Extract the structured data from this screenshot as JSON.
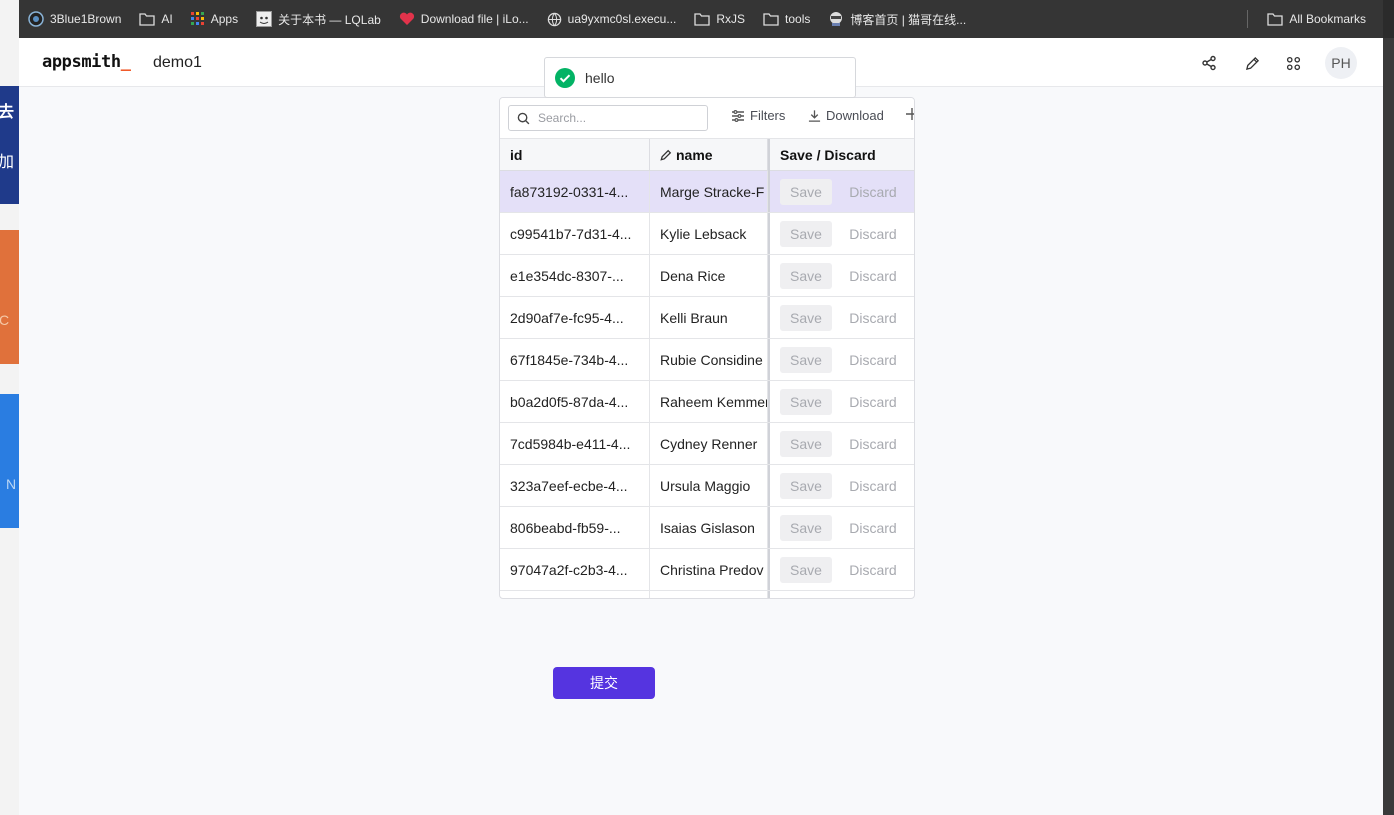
{
  "background_window": {
    "fragments": [
      "去",
      "加",
      "C",
      "N"
    ]
  },
  "bookmarks": {
    "items": [
      {
        "label": "3Blue1Brown",
        "icon": "3b1b-icon"
      },
      {
        "label": "AI",
        "icon": "folder-icon"
      },
      {
        "label": "Apps",
        "icon": "apps-grid-icon"
      },
      {
        "label": "关于本书 — LQLab",
        "icon": "lqlab-favicon"
      },
      {
        "label": "Download file | iLo...",
        "icon": "heart-icon"
      },
      {
        "label": "ua9yxmc0sl.execu...",
        "icon": "globe-icon"
      },
      {
        "label": "RxJS",
        "icon": "folder-icon"
      },
      {
        "label": "tools",
        "icon": "folder-icon"
      },
      {
        "label": "博客首页 | 猫哥在线...",
        "icon": "blog-favicon"
      }
    ],
    "all_bookmarks": "All Bookmarks"
  },
  "header": {
    "logo": "appsmith",
    "logo_suffix": "_",
    "app_name": "demo1",
    "avatar": "PH"
  },
  "toast": {
    "message": "hello",
    "icon": "check-circle-icon"
  },
  "table": {
    "search_placeholder": "Search...",
    "filters_label": "Filters",
    "download_label": "Download",
    "columns": {
      "id": "id",
      "name": "name",
      "actions": "Save / Discard"
    },
    "save_label": "Save",
    "discard_label": "Discard",
    "rows": [
      {
        "id": "fa873192-0331-4...",
        "name": "Marge Stracke-F",
        "selected": true
      },
      {
        "id": "c99541b7-7d31-4...",
        "name": "Kylie Lebsack"
      },
      {
        "id": "e1e354dc-8307-...",
        "name": "Dena Rice"
      },
      {
        "id": "2d90af7e-fc95-4...",
        "name": "Kelli Braun"
      },
      {
        "id": "67f1845e-734b-4...",
        "name": "Rubie Considine"
      },
      {
        "id": "b0a2d0f5-87da-4...",
        "name": "Raheem Kemmer"
      },
      {
        "id": "7cd5984b-e411-4...",
        "name": "Cydney Renner"
      },
      {
        "id": "323a7eef-ecbe-4...",
        "name": "Ursula Maggio"
      },
      {
        "id": "806beabd-fb59-...",
        "name": "Isaias Gislason"
      },
      {
        "id": "97047a2f-c2b3-4...",
        "name": "Christina Predov"
      }
    ]
  },
  "submit_label": "提交",
  "colors": {
    "accent": "#5534e0",
    "selected_row": "#e4e0f8",
    "success": "#03b365",
    "logo_underscore": "#f05a2a"
  }
}
